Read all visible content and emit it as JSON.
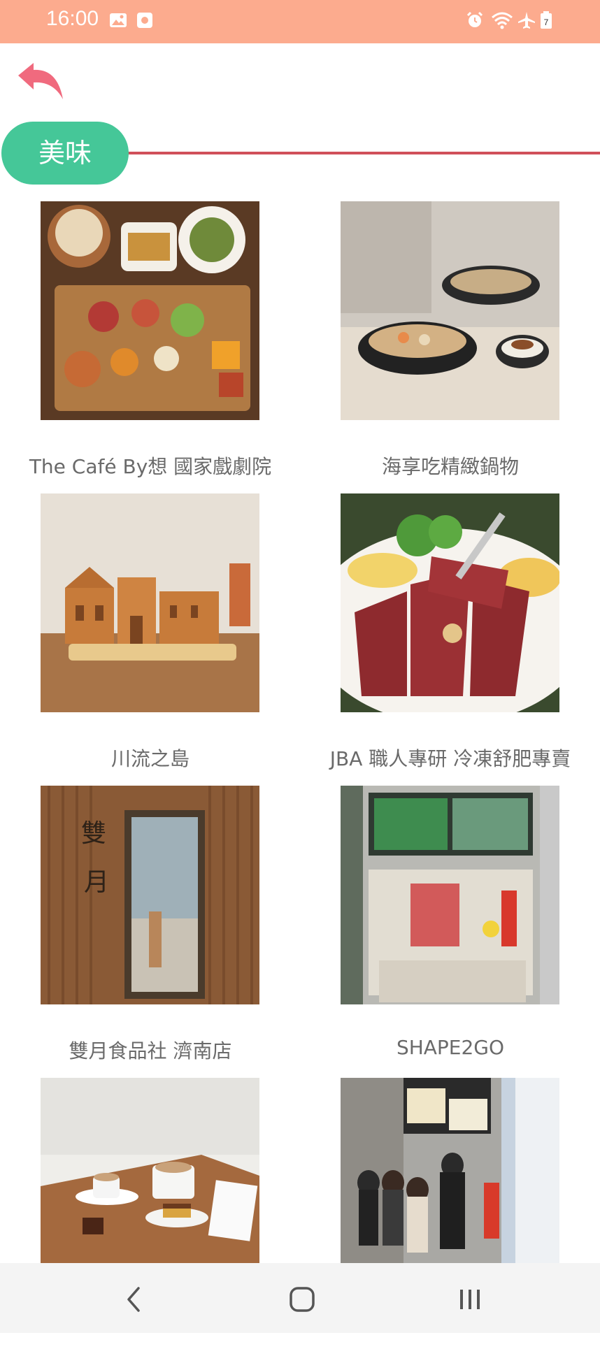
{
  "status_bar": {
    "time": "16:00",
    "battery_level": "7",
    "color": "#fcab8e",
    "icons": [
      "image-icon",
      "app-icon",
      "alarm-icon",
      "wifi-icon",
      "airplane-icon",
      "battery-icon"
    ]
  },
  "header": {
    "back_icon": "back-arrow-icon",
    "back_color": "#f06a7e"
  },
  "category": {
    "label": "美味",
    "pill_color": "#45c798",
    "line_color": "#d0505a"
  },
  "restaurants": [
    {
      "name": "The Café By想 國家戲劇院",
      "image": "platter-of-grilled-meats-and-seafood"
    },
    {
      "name": "海享吃精緻鍋物",
      "image": "clam-hotpot-with-rice-bowl"
    },
    {
      "name": "川流之島",
      "image": "castle-shaped-waffle-cake"
    },
    {
      "name": "JBA 職人專研 冷凍舒肥專賣",
      "image": "sliced-steak-with-salad"
    },
    {
      "name": "雙月食品社 濟南店",
      "image": "wooden-storefront-entrance"
    },
    {
      "name": "SHAPE2GO",
      "image": "salad-shop-counter"
    },
    {
      "name": "",
      "image": "cafe-table-with-coffee-and-cake"
    },
    {
      "name": "",
      "image": "queue-outside-street-shop"
    }
  ],
  "nav_bar": {
    "icons": [
      "back-nav-icon",
      "home-nav-icon",
      "recents-nav-icon"
    ]
  }
}
